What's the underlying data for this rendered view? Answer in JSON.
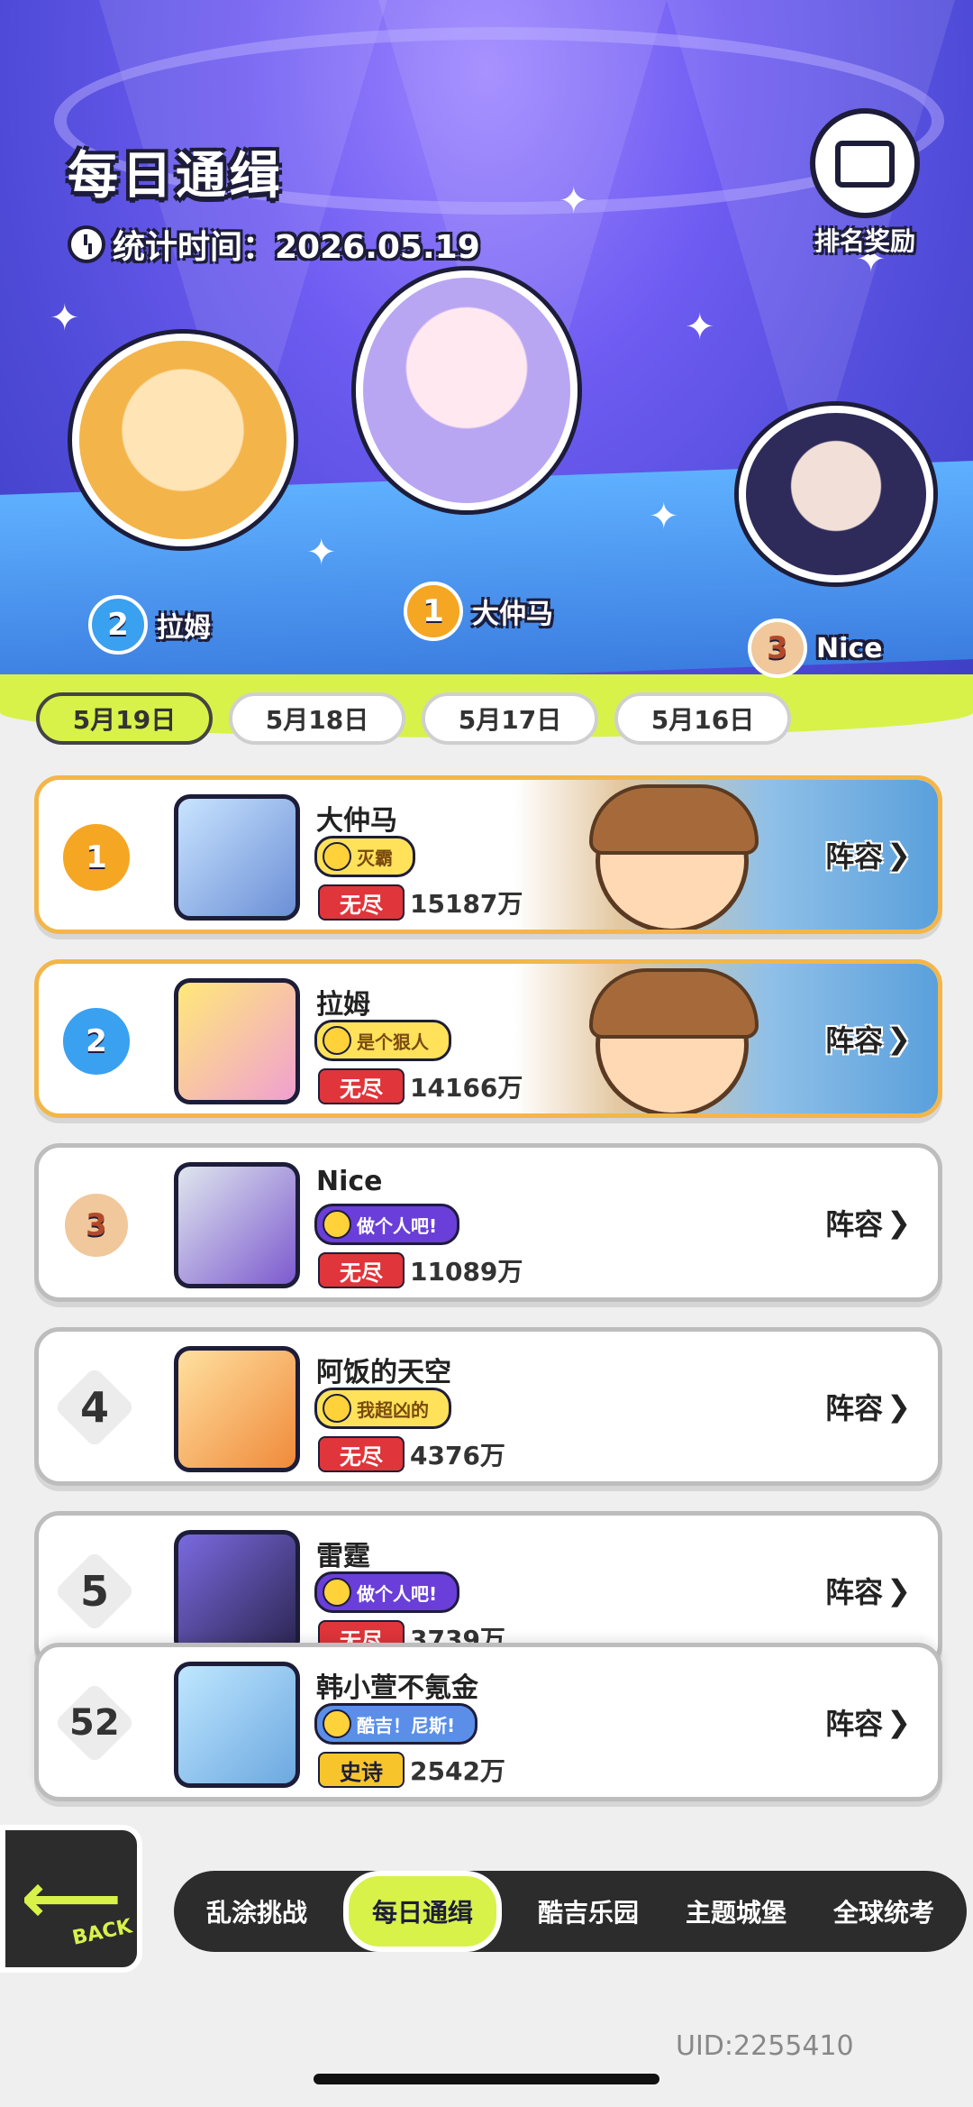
{
  "header": {
    "title": "每日通缉",
    "stat_label": "统计时间：2026.05.19",
    "reward_label": "排名奖励"
  },
  "podium": [
    {
      "rank": "2",
      "name": "拉姆"
    },
    {
      "rank": "1",
      "name": "大仲马"
    },
    {
      "rank": "3",
      "name": "Nice"
    }
  ],
  "date_tabs": [
    "5月19日",
    "5月18日",
    "5月17日",
    "5月16日"
  ],
  "rows": [
    {
      "rank": "1",
      "name": "大仲马",
      "tag": "灭霸",
      "mode": "无尽",
      "score": "15187万"
    },
    {
      "rank": "2",
      "name": "拉姆",
      "tag": "是个狠人",
      "mode": "无尽",
      "score": "14166万"
    },
    {
      "rank": "3",
      "name": "Nice",
      "tag": "做个人吧!",
      "mode": "无尽",
      "score": "11089万"
    },
    {
      "rank": "4",
      "name": "阿饭的天空",
      "tag": "我超凶的",
      "mode": "无尽",
      "score": "4376万"
    },
    {
      "rank": "5",
      "name": "雷霆",
      "tag": "做个人吧!",
      "mode": "无尽",
      "score": "3739万"
    }
  ],
  "lineup_label": "阵容",
  "my_row": {
    "rank": "52",
    "name": "韩小萱不氪金",
    "tag": "酷吉！尼斯!",
    "mode": "史诗",
    "score": "2542万"
  },
  "back_label": "BACK",
  "nav": [
    "乱涂挑战",
    "每日通缉",
    "酷吉乐园",
    "主题城堡",
    "全球统考"
  ],
  "uid": "UID:2255410"
}
